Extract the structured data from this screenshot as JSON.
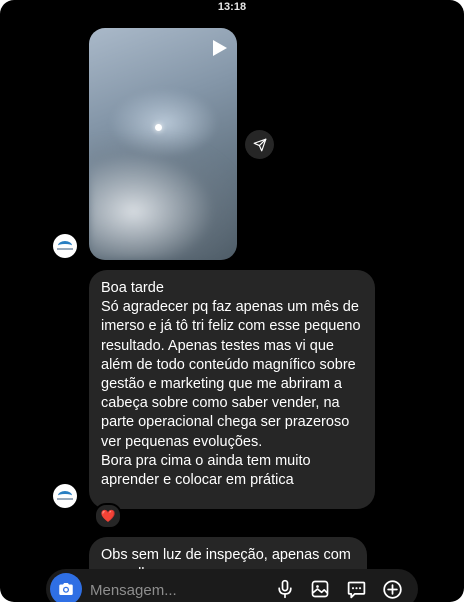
{
  "status_bar": {
    "time": "13:18"
  },
  "messages": {
    "video_reply": {
      "media": "video-thumbnail",
      "play_icon": "play-icon",
      "share_icon": "share-icon"
    },
    "main_text": [
      "Boa tarde",
      "Só agradecer pq faz apenas um mês de imerso e já tô tri feliz com esse pequeno resultado. Apenas testes mas vi que além de todo conteúdo magnífico sobre gestão e marketing que me abriram a cabeça sobre como saber vender,  na parte operacional chega ser prazeroso ver pequenas evoluções.",
      "Bora pra cima o ainda tem muito aprender e colocar em prática"
    ],
    "reaction": "❤️",
    "partial_text": "Obs sem luz de inspeção, apenas com aparelho..."
  },
  "composer": {
    "placeholder": "Mensagem...",
    "icons": [
      "camera-icon",
      "microphone-icon",
      "gallery-icon",
      "sticker-icon",
      "plus-icon"
    ]
  },
  "colors": {
    "background": "#000000",
    "bubble": "#262626",
    "accent": "#2f6fe4",
    "heart": "#ff3040"
  }
}
